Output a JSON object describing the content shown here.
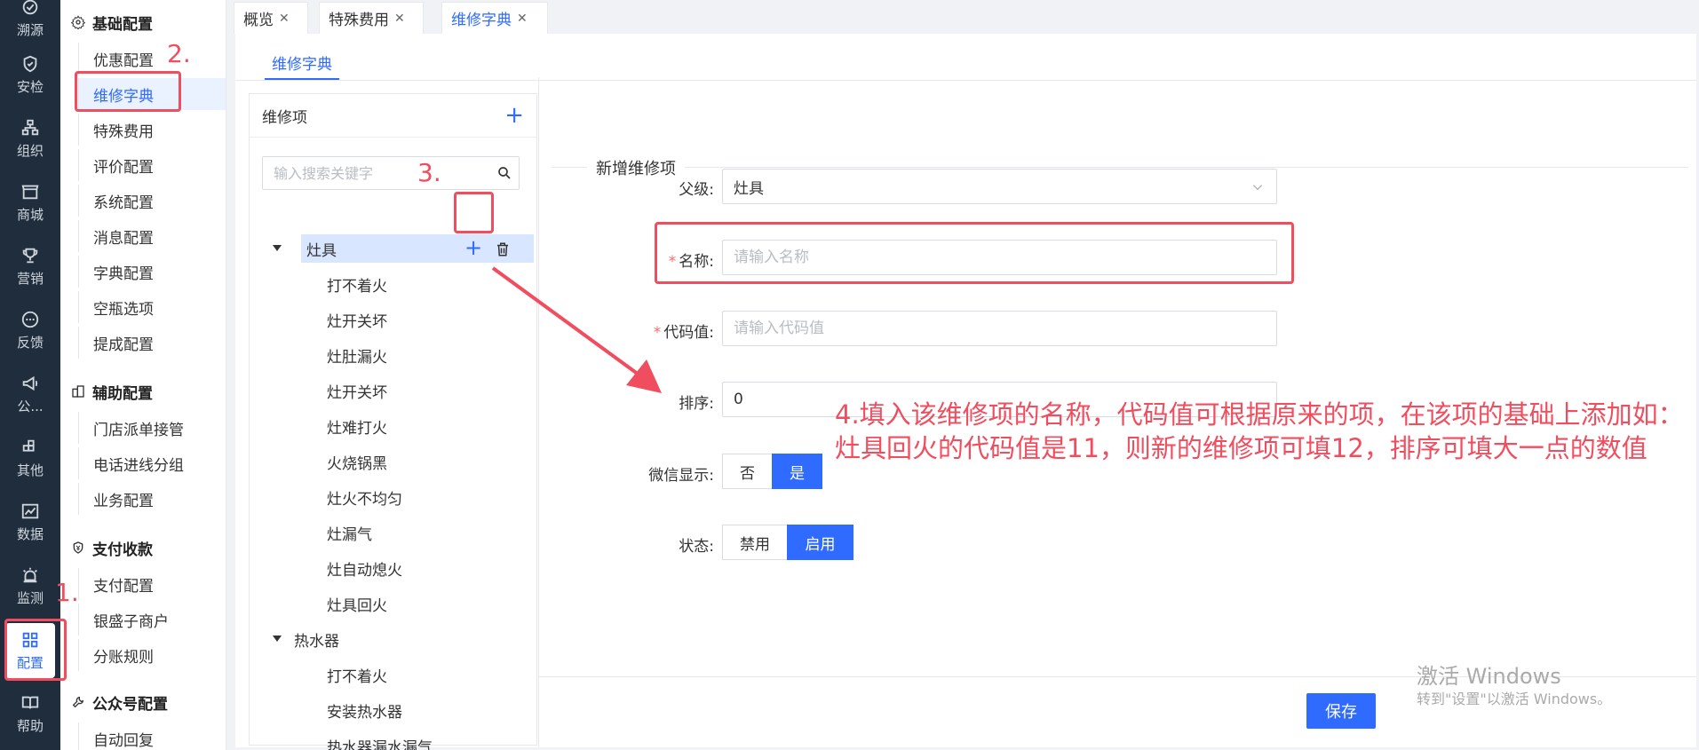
{
  "rail": [
    {
      "label": "溯源",
      "icon": "trace-icon"
    },
    {
      "label": "安检",
      "icon": "shield-check-icon"
    },
    {
      "label": "组织",
      "icon": "org-chart-icon"
    },
    {
      "label": "商城",
      "icon": "store-icon"
    },
    {
      "label": "营销",
      "icon": "trophy-icon"
    },
    {
      "label": "反馈",
      "icon": "chat-bubble-icon"
    },
    {
      "label": "公...",
      "icon": "megaphone-icon"
    },
    {
      "label": "其他",
      "icon": "grid-plus-icon"
    },
    {
      "label": "数据",
      "icon": "line-chart-icon"
    },
    {
      "label": "监测",
      "icon": "alarm-icon"
    },
    {
      "label": "配置",
      "icon": "apps-icon"
    },
    {
      "label": "帮助",
      "icon": "book-icon"
    }
  ],
  "menu": {
    "groups": [
      {
        "title": "基础配置",
        "icon": "gear-icon",
        "items": [
          "优惠配置",
          "维修字典",
          "特殊费用",
          "评价配置",
          "系统配置",
          "消息配置",
          "字典配置",
          "空瓶选项",
          "提成配置"
        ]
      },
      {
        "title": "辅助配置",
        "icon": "building-icon",
        "items": [
          "门店派单接管",
          "电话进线分组",
          "业务配置"
        ]
      },
      {
        "title": "支付收款",
        "icon": "yen-shield-icon",
        "items": [
          "支付配置",
          "银盛子商户",
          "分账规则"
        ]
      },
      {
        "title": "公众号配置",
        "icon": "wrench-icon",
        "items": [
          "自动回复"
        ]
      }
    ],
    "active_item": "维修字典"
  },
  "tabs": [
    {
      "label": "概览"
    },
    {
      "label": "特殊费用"
    },
    {
      "label": "维修字典"
    }
  ],
  "subtab": "维修字典",
  "tree": {
    "title": "维修项",
    "search_placeholder": "输入搜索关键字",
    "nodes": [
      {
        "label": "灶具",
        "children": [
          "打不着火",
          "灶开关坏",
          "灶肚漏火",
          "灶开关坏",
          "灶难打火",
          "火烧锅黑",
          "灶火不均匀",
          "灶漏气",
          "灶自动熄火",
          "灶具回火"
        ]
      },
      {
        "label": "热水器",
        "children": [
          "打不着火",
          "安装热水器",
          "热水器漏水漏气"
        ]
      }
    ]
  },
  "form": {
    "title": "新增维修项",
    "parent_label": "父级:",
    "parent_value": "灶具",
    "name_label": "名称:",
    "name_placeholder": "请输入名称",
    "code_label": "代码值:",
    "code_placeholder": "请输入代码值",
    "sort_label": "排序:",
    "sort_value": "0",
    "wechat_label": "微信显示:",
    "wechat_options": [
      "否",
      "是"
    ],
    "status_label": "状态:",
    "status_options": [
      "禁用",
      "启用"
    ],
    "save_label": "保存"
  },
  "annotations": {
    "step1": "1.",
    "step2": "2.",
    "step3": "3.",
    "step4": "4.填入该维修项的名称，代码值可根据原来的项，在该项的基础上添加如：灶具回火的代码值是11，则新的维修项可填12，排序可填大一点的数值"
  },
  "watermark": {
    "line1": "激活 Windows",
    "line2": "转到\"设置\"以激活 Windows。"
  },
  "colors": {
    "accent": "#2f6bff",
    "annotation": "#f04d5f",
    "rail_bg": "#1f2d3d"
  }
}
